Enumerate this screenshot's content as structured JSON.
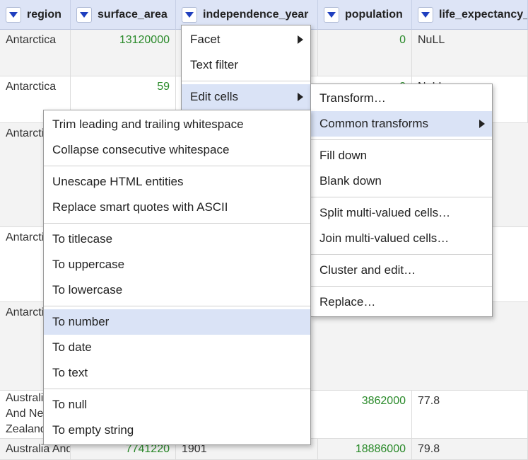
{
  "columns": [
    {
      "label": "region"
    },
    {
      "label": "surface_area"
    },
    {
      "label": "independence_year"
    },
    {
      "label": "population"
    },
    {
      "label": "life_expectancy_"
    }
  ],
  "rows": [
    {
      "region": "Antarctica",
      "surface_area": "13120000",
      "independence_year": "",
      "population": "0",
      "life_expectancy": "NuLL"
    },
    {
      "region": "Antarctica",
      "surface_area": "59",
      "independence_year": "",
      "population": "0",
      "life_expectancy": "NuLL"
    },
    {
      "region": "Antarctica",
      "surface_area": "",
      "independence_year": "",
      "population": "",
      "life_expectancy": ""
    },
    {
      "region": "Antarctica",
      "surface_area": "",
      "independence_year": "",
      "population": "",
      "life_expectancy": ""
    },
    {
      "region": "Antarctica",
      "surface_area": "",
      "independence_year": "",
      "population": "",
      "life_expectancy": ""
    },
    {
      "region": "Australia And New Zealand",
      "surface_area": "",
      "independence_year": "",
      "population": "3862000",
      "life_expectancy": "77.8"
    },
    {
      "region": "Australia And New",
      "surface_area": "7741220",
      "independence_year": "1901",
      "population": "18886000",
      "life_expectancy": "79.8"
    }
  ],
  "column_menu": {
    "items": [
      {
        "label": "Facet",
        "submenu": true
      },
      {
        "label": "Text filter",
        "submenu": false
      },
      {
        "label": "Edit cells",
        "submenu": true
      }
    ]
  },
  "edit_cells_menu": {
    "items": [
      {
        "label": "Transform…"
      },
      {
        "label": "Common transforms"
      },
      {
        "label": "Fill down"
      },
      {
        "label": "Blank down"
      },
      {
        "label": "Split multi-valued cells…"
      },
      {
        "label": "Join multi-valued cells…"
      },
      {
        "label": "Cluster and edit…"
      },
      {
        "label": "Replace…"
      }
    ]
  },
  "common_transforms_menu": {
    "items": [
      {
        "label": "Trim leading and trailing whitespace"
      },
      {
        "label": "Collapse consecutive whitespace"
      },
      {
        "label": "Unescape HTML entities"
      },
      {
        "label": "Replace smart quotes with ASCII"
      },
      {
        "label": "To titlecase"
      },
      {
        "label": "To uppercase"
      },
      {
        "label": "To lowercase"
      },
      {
        "label": "To number"
      },
      {
        "label": "To date"
      },
      {
        "label": "To text"
      },
      {
        "label": "To null"
      },
      {
        "label": "To empty string"
      }
    ]
  },
  "colors": {
    "header_bg": "#dde4f6",
    "numeric_text": "#2a8a2a",
    "menu_highlight": "#dae3f6",
    "row_alt": "#f3f3f3"
  },
  "icons": {
    "column_dropdown": "triangle-down-icon",
    "submenu": "triangle-right-icon"
  }
}
